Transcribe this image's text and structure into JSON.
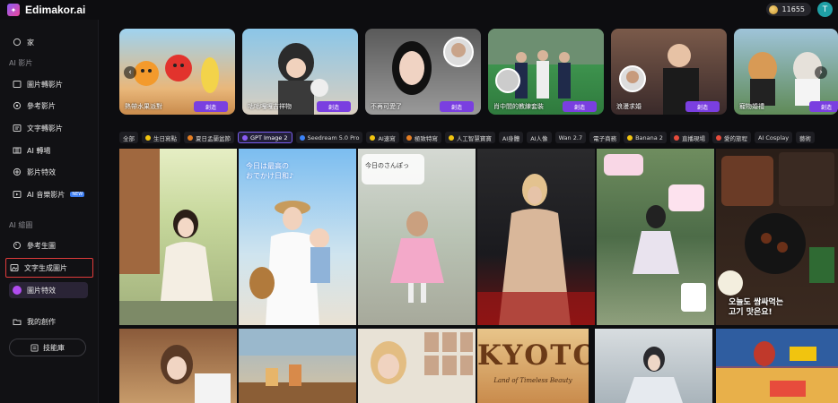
{
  "brand": {
    "name": "Edimakor.ai"
  },
  "header": {
    "credits": "11655",
    "avatar_initial": "T"
  },
  "sidebar": {
    "home": "家",
    "section_video": "AI 影片",
    "video_items": [
      "圖片轉影片",
      "參考影片",
      "文字轉影片",
      "AI 轉場",
      "影片特效",
      "AI 音樂影片"
    ],
    "new_badge": "NEW",
    "section_image": "AI 繪圖",
    "image_items": [
      "參考生圖",
      "文字生成圖片",
      "圖片特效"
    ],
    "my_creations": "我的創作",
    "asset_library": "技能庫"
  },
  "carousel": {
    "prev": "‹",
    "next": "›",
    "cards": [
      {
        "caption": "熱帶水果派對",
        "button": "創造"
      },
      {
        "caption": "咕咕嘎嘎吉祥物",
        "button": "創造"
      },
      {
        "caption": "不再可愛了",
        "button": "創造"
      },
      {
        "caption": "肖中間的教練套裝",
        "button": "創造"
      },
      {
        "caption": "浪漫求婚",
        "button": "創造"
      },
      {
        "caption": "寵物婚禮",
        "button": "創造"
      }
    ]
  },
  "categories": [
    "全部",
    "生日寫點",
    "夏日孟蘭盆節",
    "GPT Image 2",
    "Seedream 5.0 Pro",
    "AI速寫",
    "極致特寫",
    "人工智慧寶寶",
    "AI身體",
    "AI人像",
    "Wan 2.7",
    "電子商務",
    "Banana 2",
    "直播現場",
    "愛的旅程",
    "AI Cosplay",
    "藝術"
  ],
  "category_selected": "GPT Image 2",
  "gallery": {
    "jp_title_line1": "今日は最高の",
    "jp_title_line2": "おでかけ日和♪",
    "jp_note": "今日のさんぽっ",
    "korean_line1": "오늘도 쌈싸먹는",
    "korean_line2": "고기 맛은요!",
    "kyoto_title": "KYOTO",
    "kyoto_subtitle": "Land of Timeless Beauty"
  },
  "colors": {
    "accent": "#7a3fe0",
    "highlight_border": "#e03b3b",
    "active_bg": "#2a2436"
  }
}
